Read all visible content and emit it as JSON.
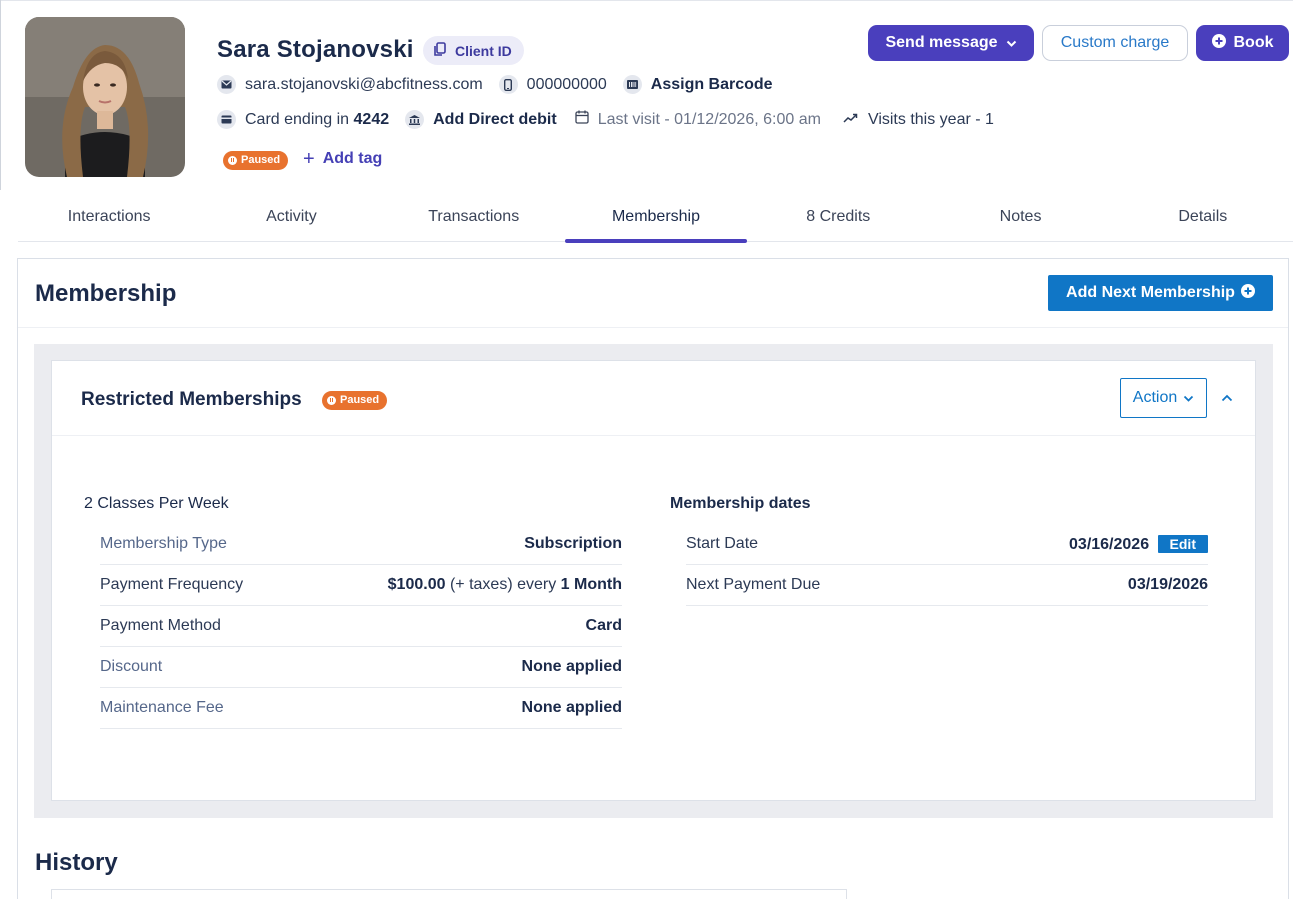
{
  "profile": {
    "name": "Sara Stojanovski",
    "client_id_label": "Client ID",
    "email": "sara.stojanovski@abcfitness.com",
    "phone": "000000000",
    "assign_barcode": "Assign Barcode",
    "card_prefix": "Card ending in",
    "card_last4": "4242",
    "add_direct_debit": "Add Direct debit",
    "last_visit": "Last visit - 01/12/2026, 6:00 am",
    "visits_year": "Visits this year - 1",
    "status_badge": "Paused",
    "add_tag": "Add tag"
  },
  "actions": {
    "send_message": "Send message",
    "custom_charge": "Custom charge",
    "book": "Book"
  },
  "tabs": [
    {
      "label": "Interactions"
    },
    {
      "label": "Activity"
    },
    {
      "label": "Transactions"
    },
    {
      "label": "Membership",
      "active": true
    },
    {
      "label": "8 Credits"
    },
    {
      "label": "Notes"
    },
    {
      "label": "Details"
    }
  ],
  "membership": {
    "title": "Membership",
    "add_next_label": "Add Next Membership",
    "card": {
      "title": "Restricted Memberships",
      "status_badge": "Paused",
      "action_label": "Action",
      "plan_name": "2 Classes Per Week",
      "rows": [
        {
          "label": "Membership Type",
          "value": "Subscription"
        },
        {
          "label": "Payment Frequency",
          "amount": "$100.00",
          "taxes": "(+ taxes) every",
          "period": "1 Month"
        },
        {
          "label": "Payment Method",
          "value": "Card"
        },
        {
          "label": "Discount",
          "value": "None applied"
        },
        {
          "label": "Maintenance Fee",
          "value": "None applied"
        }
      ],
      "dates_title": "Membership dates",
      "dates": [
        {
          "label": "Start Date",
          "value": "03/16/2026",
          "edit_label": "Edit"
        },
        {
          "label": "Next Payment Due",
          "value": "03/19/2026"
        }
      ]
    },
    "history_title": "History"
  },
  "colors": {
    "primary_purple": "#4a3fbd",
    "primary_blue": "#1076c6",
    "paused_orange": "#e8722e",
    "text_navy": "#1b2a4a"
  }
}
